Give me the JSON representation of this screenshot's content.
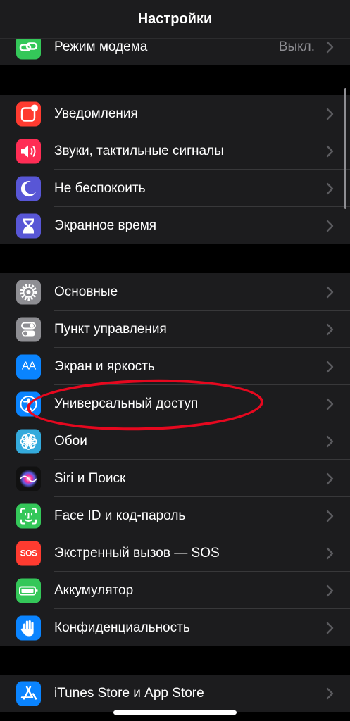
{
  "header": {
    "title": "Настройки"
  },
  "groups": [
    {
      "rows": [
        {
          "id": "hotspot",
          "label": "Режим модема",
          "value": "Выкл.",
          "icon": "personal-hotspot-icon",
          "color": "#34c759"
        }
      ]
    },
    {
      "rows": [
        {
          "id": "notifications",
          "label": "Уведомления",
          "icon": "notifications-icon",
          "color": "#ff3b30"
        },
        {
          "id": "sounds",
          "label": "Звуки, тактильные сигналы",
          "icon": "speaker-icon",
          "color": "#ff2d55"
        },
        {
          "id": "dnd",
          "label": "Не беспокоить",
          "icon": "moon-icon",
          "color": "#5856d6"
        },
        {
          "id": "screen-time",
          "label": "Экранное время",
          "icon": "hourglass-icon",
          "color": "#5856d6"
        }
      ]
    },
    {
      "rows": [
        {
          "id": "general",
          "label": "Основные",
          "icon": "gear-icon",
          "color": "#8e8e93"
        },
        {
          "id": "control-center",
          "label": "Пункт управления",
          "icon": "toggles-icon",
          "color": "#8e8e93"
        },
        {
          "id": "display",
          "label": "Экран и яркость",
          "icon": "text-size-icon",
          "glyph": "AA",
          "color": "#0a84ff"
        },
        {
          "id": "accessibility",
          "label": "Универсальный доступ",
          "icon": "accessibility-icon",
          "color": "#0a84ff"
        },
        {
          "id": "wallpaper",
          "label": "Обои",
          "icon": "flower-icon",
          "color": "#34aadc"
        },
        {
          "id": "siri",
          "label": "Siri и Поиск",
          "icon": "siri-icon",
          "color": "#1c1c1e"
        },
        {
          "id": "face-id",
          "label": "Face ID и код-пароль",
          "icon": "face-id-icon",
          "color": "#34c759"
        },
        {
          "id": "sos",
          "label": "Экстренный вызов — SOS",
          "icon": "sos-icon",
          "glyph": "SOS",
          "color": "#ff3b30"
        },
        {
          "id": "battery",
          "label": "Аккумулятор",
          "icon": "battery-icon",
          "color": "#34c759"
        },
        {
          "id": "privacy",
          "label": "Конфиденциальность",
          "icon": "hand-icon",
          "color": "#0a84ff"
        }
      ]
    },
    {
      "rows": [
        {
          "id": "app-store",
          "label": "iTunes Store и App Store",
          "icon": "app-store-icon",
          "color": "#0a84ff"
        }
      ]
    }
  ]
}
